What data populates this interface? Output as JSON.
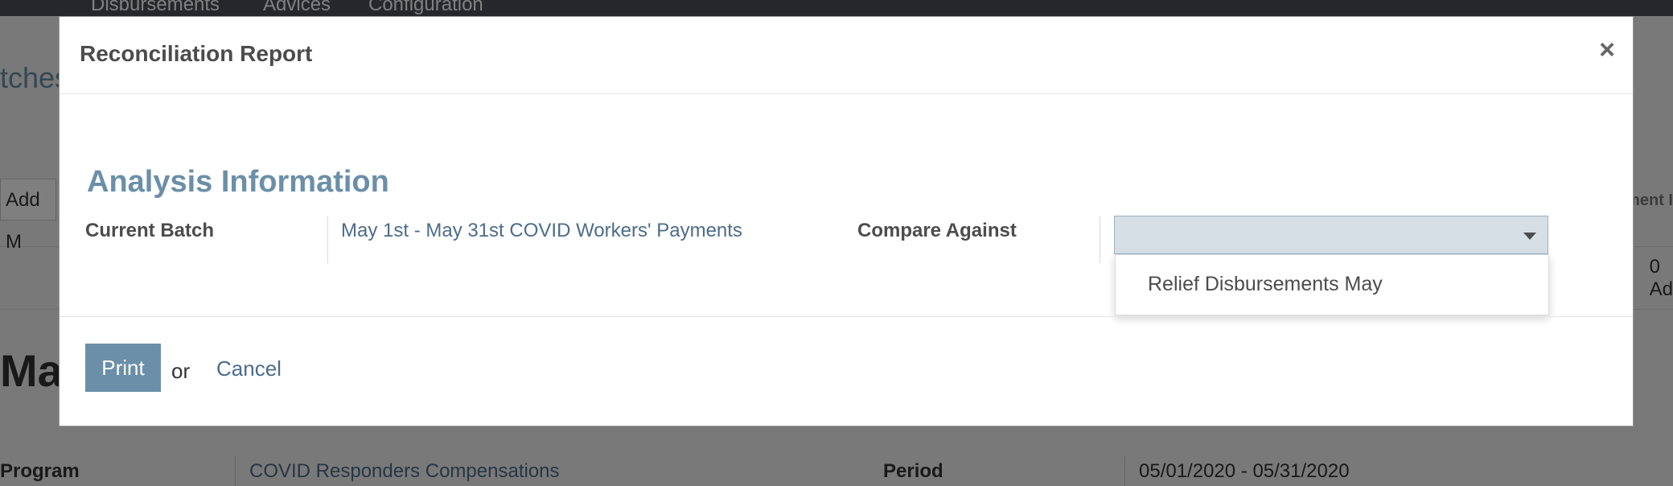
{
  "background": {
    "nav_items": [
      "Disbursements",
      "Advices",
      "Configuration"
    ],
    "breadcrumb": "tches",
    "action_button": "Add M",
    "right_label": "ment I",
    "stat_count": "0",
    "stat_label": "Ad",
    "record_title": "May",
    "program_label": "Program",
    "program_value": "COVID Responders Compensations",
    "period_label": "Period",
    "period_value": "05/01/2020 - 05/31/2020"
  },
  "modal": {
    "title": "Reconciliation Report",
    "close_symbol": "×",
    "section_title": "Analysis Information",
    "current_batch_label": "Current Batch",
    "current_batch_value": "May 1st - May 31st COVID Workers' Payments",
    "compare_label": "Compare Against",
    "compare_value": "",
    "compare_options": [
      "Relief Disbursements May"
    ],
    "print_label": "Print",
    "or_text": "or",
    "cancel_label": "Cancel"
  },
  "colors": {
    "accent": "#6b8fa8",
    "link": "#4c6c8a",
    "select_bg": "#d6dfe5"
  }
}
